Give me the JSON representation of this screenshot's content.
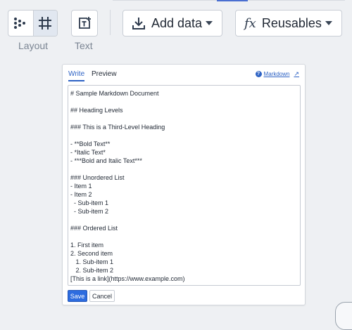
{
  "toolbar": {
    "layout_label": "Layout",
    "text_label": "Text",
    "add_data_label": "Add data",
    "reusables_label": "Reusables",
    "reusables_fx": "fx"
  },
  "panel": {
    "tab_write": "Write",
    "tab_preview": "Preview",
    "markdown_link": "Markdown",
    "help_glyph": "?",
    "external_glyph": "↗",
    "lines": [
      "# Sample Markdown Document",
      "",
      "## Heading Levels",
      "",
      "### This is a Third-Level Heading",
      "",
      "- **Bold Text**",
      "- *Italic Text*",
      "- ***Bold and Italic Text***",
      "",
      "### Unordered List",
      "- Item 1",
      "- Item 2",
      "  - Sub-item 1",
      "  - Sub-item 2",
      "",
      "### Ordered List",
      "",
      "1. First item",
      "2. Second item",
      "   1. Sub-item 1",
      "   2. Sub-item 2",
      "[This is a link](https://www.example.com)"
    ],
    "save_label": "Save",
    "cancel_label": "Cancel"
  },
  "colors": {
    "accent": "#2d62c4",
    "background": "#eef0f3"
  },
  "icons": {
    "layout_flow": "dots-flow-icon",
    "layout_grid": "grid-icon",
    "text": "text-box-icon",
    "add_data": "download-icon",
    "dropdown": "caret-down-icon"
  }
}
